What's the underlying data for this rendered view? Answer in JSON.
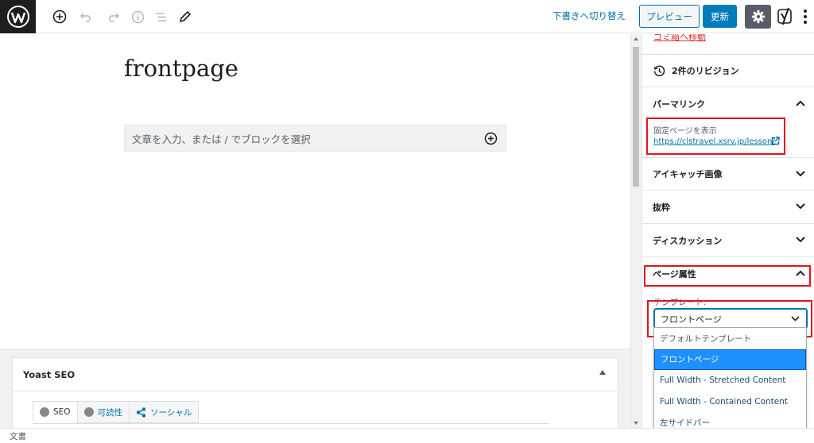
{
  "toolbar": {
    "switch_to_draft": "下書きへ切り替え",
    "preview_label": "プレビュー",
    "update_label": "更新"
  },
  "editor": {
    "title": "frontpage",
    "appender_placeholder": "文章を入力、または / でブロックを選択"
  },
  "yoast": {
    "title": "Yoast SEO",
    "tabs": [
      {
        "label": "SEO",
        "icon": "circle-icon"
      },
      {
        "label": "可読性",
        "icon": "circle-icon"
      },
      {
        "label": "ソーシャル",
        "icon": "share-icon"
      }
    ]
  },
  "sidebar": {
    "trash_link": "ゴミ箱へ移動",
    "revisions": "2件のリビジョン",
    "permalink": {
      "heading": "パーマリンク",
      "label": "固定ページを表示",
      "url": "https://clstravel.xsrv.jp/lesson/"
    },
    "panels": {
      "featured_image": "アイキャッチ画像",
      "excerpt": "抜粋",
      "discussion": "ディスカッション",
      "page_attributes": "ページ属性"
    },
    "template": {
      "label": "テンプレート:",
      "selected": "フロントページ",
      "options": [
        "デフォルトテンプレート",
        "フロントページ",
        "Full Width - Stretched Content",
        "Full Width - Contained Content",
        "左サイドバー"
      ]
    }
  },
  "statusbar": {
    "breadcrumb": "文書"
  },
  "colors": {
    "accent": "#0073aa",
    "highlight": "#e0141e",
    "selected_option": "#1e90ff"
  }
}
